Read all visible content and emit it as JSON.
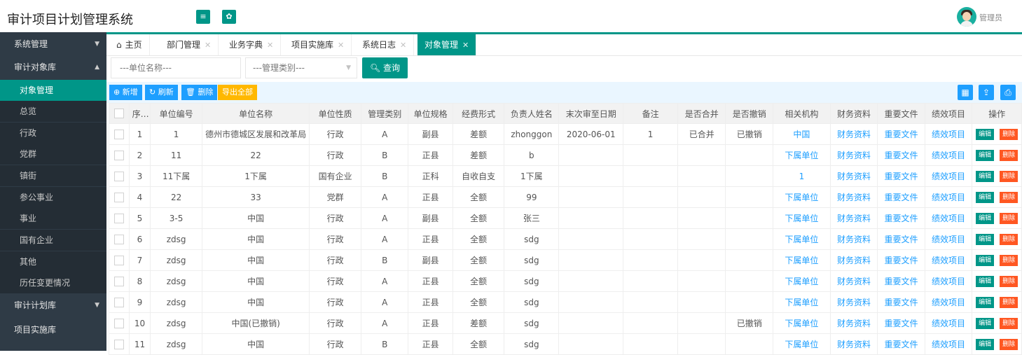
{
  "app": {
    "title": "审计项目计划管理系统",
    "user": "管理员"
  },
  "header_buttons": [
    "≡",
    "✿"
  ],
  "sidebar": [
    {
      "label": "系统管理",
      "type": "group",
      "caret": "▼"
    },
    {
      "label": "审计对象库",
      "type": "group",
      "caret": "▲"
    },
    {
      "label": "对象管理",
      "type": "sub",
      "active": true
    },
    {
      "label": "总览",
      "type": "sub"
    },
    {
      "label": "行政",
      "type": "sub"
    },
    {
      "label": "党群",
      "type": "sub"
    },
    {
      "label": "镇街",
      "type": "sub"
    },
    {
      "label": "参公事业",
      "type": "sub"
    },
    {
      "label": "事业",
      "type": "sub"
    },
    {
      "label": "国有企业",
      "type": "sub"
    },
    {
      "label": "其他",
      "type": "sub"
    },
    {
      "label": "历任变更情况",
      "type": "sub"
    },
    {
      "label": "审计计划库",
      "type": "group",
      "caret": "▼"
    },
    {
      "label": "项目实施库",
      "type": "group"
    }
  ],
  "tabs": [
    {
      "label": "主页",
      "icon": "⌂",
      "closable": false
    },
    {
      "label": "部门管理",
      "closable": true
    },
    {
      "label": "业务字典",
      "closable": true
    },
    {
      "label": "项目实施库",
      "closable": true
    },
    {
      "label": "系统日志",
      "closable": true
    },
    {
      "label": "对象管理",
      "closable": true,
      "active": true
    }
  ],
  "search": {
    "unit_placeholder": "---单位名称---",
    "category_placeholder": "---管理类别---",
    "query_label": "查询"
  },
  "toolbar": {
    "add": "新增",
    "refresh": "刷新",
    "delete": "删除",
    "export": "导出全部"
  },
  "table": {
    "headers": [
      "序号",
      "单位编号",
      "单位名称",
      "单位性质",
      "管理类别",
      "单位规格",
      "经费形式",
      "负责人姓名",
      "末次审至日期",
      "备注",
      "是否合并",
      "是否撤销",
      "相关机构",
      "财务资料",
      "重要文件",
      "绩效项目",
      "操作"
    ],
    "edit_label": "编辑",
    "delete_label": "删除",
    "rows": [
      [
        "1",
        "1",
        "德州市德城区发展和改革局",
        "行政",
        "A",
        "副县",
        "差额",
        "zhonggon",
        "2020-06-01",
        "1",
        "已合并",
        "已撤销",
        "中国",
        "财务资料",
        "重要文件",
        "绩效项目"
      ],
      [
        "2",
        "11",
        "22",
        "行政",
        "B",
        "正县",
        "差额",
        "b",
        "",
        "",
        "",
        "",
        "下属单位",
        "财务资料",
        "重要文件",
        "绩效项目"
      ],
      [
        "3",
        "11下属",
        "1下属",
        "国有企业",
        "B",
        "正科",
        "自收自支",
        "1下属",
        "",
        "",
        "",
        "",
        "1",
        "财务资料",
        "重要文件",
        "绩效项目"
      ],
      [
        "4",
        "22",
        "33",
        "党群",
        "A",
        "正县",
        "全额",
        "99",
        "",
        "",
        "",
        "",
        "下属单位",
        "财务资料",
        "重要文件",
        "绩效项目"
      ],
      [
        "5",
        "3-5",
        "中国",
        "行政",
        "A",
        "副县",
        "全额",
        "张三",
        "",
        "",
        "",
        "",
        "下属单位",
        "财务资料",
        "重要文件",
        "绩效项目"
      ],
      [
        "6",
        "zdsg",
        "中国",
        "行政",
        "A",
        "正县",
        "全额",
        "sdg",
        "",
        "",
        "",
        "",
        "下属单位",
        "财务资料",
        "重要文件",
        "绩效项目"
      ],
      [
        "7",
        "zdsg",
        "中国",
        "行政",
        "B",
        "副县",
        "全额",
        "sdg",
        "",
        "",
        "",
        "",
        "下属单位",
        "财务资料",
        "重要文件",
        "绩效项目"
      ],
      [
        "8",
        "zdsg",
        "中国",
        "行政",
        "A",
        "正县",
        "全额",
        "sdg",
        "",
        "",
        "",
        "",
        "下属单位",
        "财务资料",
        "重要文件",
        "绩效项目"
      ],
      [
        "9",
        "zdsg",
        "中国",
        "行政",
        "A",
        "正县",
        "全额",
        "sdg",
        "",
        "",
        "",
        "",
        "下属单位",
        "财务资料",
        "重要文件",
        "绩效项目"
      ],
      [
        "10",
        "zdsg",
        "中国(已撤销)",
        "行政",
        "A",
        "正县",
        "差额",
        "sdg",
        "",
        "",
        "",
        "已撤销",
        "下属单位",
        "财务资料",
        "重要文件",
        "绩效项目"
      ],
      [
        "11",
        "zdsg",
        "中国",
        "行政",
        "B",
        "正县",
        "全额",
        "sdg",
        "",
        "",
        "",
        "",
        "下属单位",
        "财务资料",
        "重要文件",
        "绩效项目"
      ]
    ]
  },
  "colors": {
    "accent": "#009688",
    "blue": "#1e9fff",
    "orange": "#ffb800",
    "danger": "#ff5722",
    "sidebar": "#2f3b46"
  }
}
